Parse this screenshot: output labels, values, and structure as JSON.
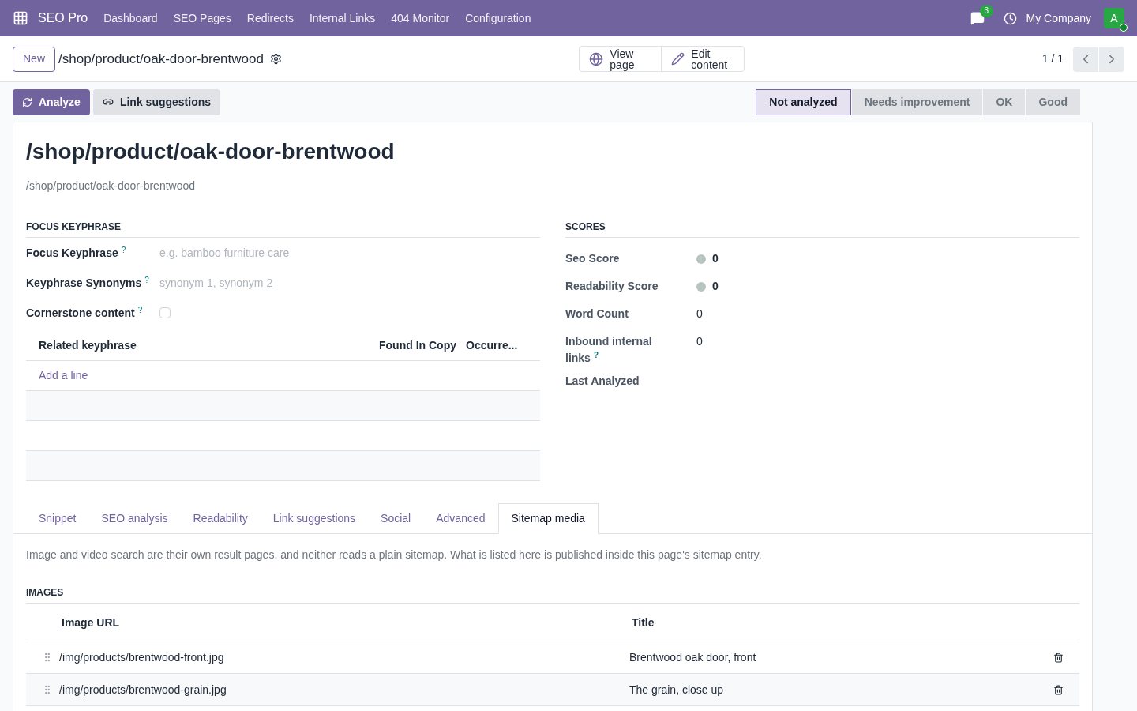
{
  "navbar": {
    "app_name": "SEO Pro",
    "menu": [
      "Dashboard",
      "SEO Pages",
      "Redirects",
      "Internal Links",
      "404 Monitor",
      "Configuration"
    ],
    "chat_badge": "3",
    "company": "My Company",
    "avatar": "A"
  },
  "control_panel": {
    "new_button": "New",
    "breadcrumb": "/shop/product/oak-door-brentwood",
    "view_button": "View page",
    "edit_button": "Edit content",
    "pager": "1 / 1"
  },
  "actions": [
    {
      "label": "Analyze",
      "primary": true
    },
    {
      "label": "Link suggestions",
      "primary": false
    }
  ],
  "stages": [
    {
      "label": "Not analyzed",
      "selected": true
    },
    {
      "label": "Needs improvement",
      "selected": false
    },
    {
      "label": "OK",
      "selected": false
    },
    {
      "label": "Good",
      "selected": false
    }
  ],
  "title": "/shop/product/oak-door-brentwood",
  "subtitle": "/shop/product/oak-door-brentwood",
  "focus": {
    "heading": "FOCUS KEYPHRASE",
    "fields": [
      {
        "kind": "text",
        "label": "Focus Keyphrase",
        "help": "?",
        "placeholder": "e.g. bamboo furniture care"
      },
      {
        "kind": "text",
        "label": "Keyphrase Synonyms",
        "help": "?",
        "placeholder": "synonym 1, synonym 2"
      },
      {
        "kind": "checkbox",
        "label": "Cornerstone content",
        "help": "?",
        "checked": false
      }
    ],
    "table": {
      "columns": [
        "Related keyphrase",
        "Found In Copy",
        "Occurre..."
      ],
      "add_line": "Add a line"
    }
  },
  "scores": {
    "heading": "SCORES",
    "rows": [
      {
        "kind": "dot",
        "label": "Seo Score",
        "value": "0",
        "color": "#b8c4bf"
      },
      {
        "kind": "dot",
        "label": "Readability Score",
        "value": "0",
        "color": "#b8c4bf"
      },
      {
        "kind": "plain",
        "label": "Word Count",
        "value": "0"
      },
      {
        "kind": "plain",
        "label": "Inbound internal links",
        "help": "?",
        "value": "0"
      },
      {
        "kind": "plain",
        "label": "Last Analyzed"
      }
    ]
  },
  "tabs": [
    {
      "label": "Snippet",
      "selected": false
    },
    {
      "label": "SEO analysis",
      "selected": false
    },
    {
      "label": "Readability",
      "selected": false
    },
    {
      "label": "Link suggestions",
      "selected": false
    },
    {
      "label": "Social",
      "selected": false
    },
    {
      "label": "Advanced",
      "selected": false
    },
    {
      "label": "Sitemap media",
      "selected": true
    }
  ],
  "sitemap": {
    "description": "Image and video search are their own result pages, and neither reads a plain sitemap. What is listed here is published inside this page's sitemap entry.",
    "images_heading": "IMAGES",
    "columns": [
      "Image URL",
      "Title"
    ],
    "rows": [
      {
        "url": "/img/products/brentwood-front.jpg",
        "title": "Brentwood oak door, front"
      },
      {
        "url": "/img/products/brentwood-grain.jpg",
        "title": "The grain, close up"
      }
    ]
  }
}
